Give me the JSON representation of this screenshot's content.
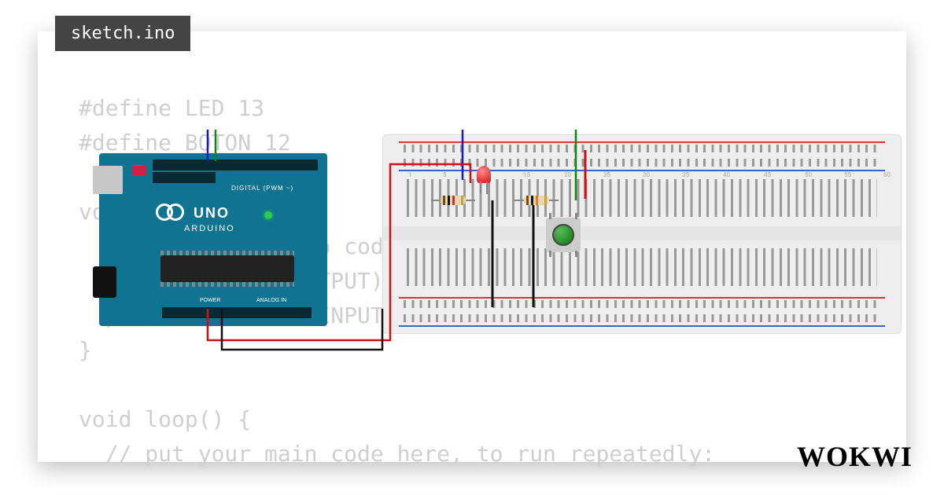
{
  "tab": {
    "filename": "sketch.ino"
  },
  "code": {
    "lines": "#define LED 13\n#define BOTON 12\n\nvoid setup() {\n  // put your setup code here, to run once:\n  pinMode (LED, OUTPUT);\n  pinMode (BOTON, INPUT);\n}\n\nvoid loop() {\n  // put your main code here, to run repeatedly:"
  },
  "board": {
    "name": "UNO",
    "brand": "ARDUINO",
    "digital_label": "DIGITAL (PWM ~)",
    "analog_label": "ANALOG IN",
    "power_label": "POWER"
  },
  "components": {
    "led1": {
      "color": "red"
    },
    "resistor1": {
      "bands": [
        "brown",
        "black",
        "red",
        "gold"
      ]
    },
    "resistor2": {
      "bands": [
        "brown",
        "black",
        "orange",
        "gold"
      ]
    },
    "button1": {
      "color": "green"
    }
  },
  "wires": [
    {
      "name": "d13-to-led",
      "color": "#1818c8"
    },
    {
      "name": "d12-to-button",
      "color": "#0a8a0a"
    },
    {
      "name": "5v-to-rail",
      "color": "#d01010"
    },
    {
      "name": "gnd-to-rail",
      "color": "#111"
    },
    {
      "name": "rail-to-res1",
      "color": "#111"
    },
    {
      "name": "rail-to-btn-gnd",
      "color": "#111"
    },
    {
      "name": "btn-to-5v",
      "color": "#d01010"
    }
  ],
  "brand_footer": "WOKWI"
}
